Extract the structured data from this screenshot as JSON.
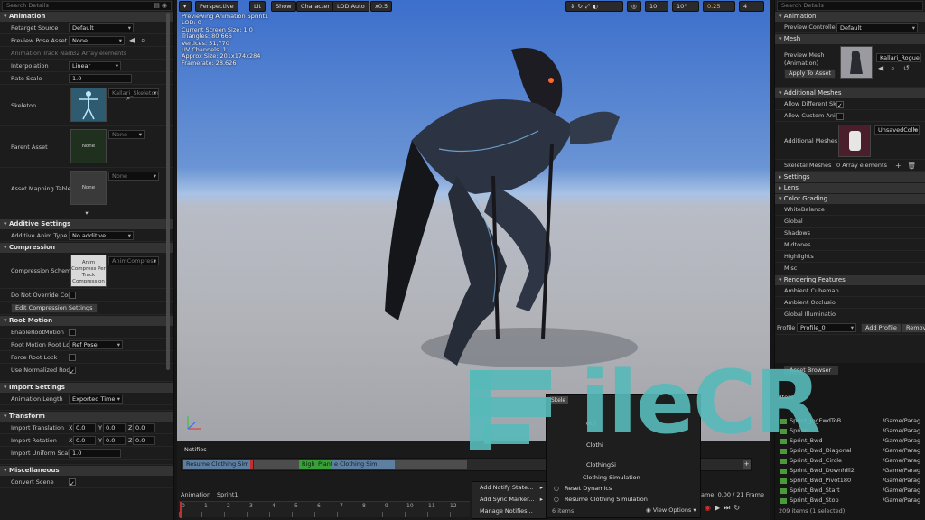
{
  "left_panel": {
    "search_placeholder": "Search Details",
    "categories": {
      "animation": "Animation",
      "additive": "Additive Settings",
      "compression": "Compression",
      "root_motion": "Root Motion",
      "import": "Import Settings",
      "transform": "Transform",
      "misc": "Miscellaneous"
    },
    "animation": {
      "retarget_label": "Retarget Source",
      "retarget_value": "Default",
      "preview_pose_label": "Preview Pose Asset",
      "preview_pose_value": "None",
      "track_names_label": "Animation Track Nam",
      "track_names_value": "132 Array elements",
      "interpolation_label": "Interpolation",
      "interpolation_value": "Linear",
      "rate_scale_label": "Rate Scale",
      "rate_scale_value": "1.0",
      "skeleton_label": "Skeleton",
      "skeleton_value": "Kallari_Skeleton",
      "parent_label": "Parent Asset",
      "parent_thumb": "None",
      "parent_value": "None",
      "mapping_label": "Asset Mapping Table",
      "mapping_thumb": "None",
      "mapping_value": "None"
    },
    "additive": {
      "anim_type_label": "Additive Anim Type",
      "anim_type_value": "No additive"
    },
    "compression": {
      "scheme_label": "Compression Schem",
      "scheme_thumb": "Anim Compress Per Track Compression",
      "scheme_value": "AnimCompress",
      "no_override_label": "Do Not Override Com",
      "edit_button": "Edit Compression Settings"
    },
    "root_motion": {
      "enable_label": "EnableRootMotion",
      "lock_label": "Root Motion Root Loc",
      "lock_value": "Ref Pose",
      "force_lock_label": "Force Root Lock",
      "normalized_label": "Use Normalized Root"
    },
    "import": {
      "length_label": "Animation Length",
      "length_value": "Exported Time"
    },
    "transform": {
      "translation_label": "Import Translation",
      "rotation_label": "Import Rotation",
      "scale_label": "Import Uniform Scale",
      "scale_value": "1.0",
      "axis_x": "X",
      "axis_y": "Y",
      "axis_z": "Z",
      "zero": "0.0"
    },
    "misc": {
      "convert_scene_label": "Convert Scene"
    }
  },
  "viewport": {
    "toolbar": {
      "perspective": "Perspective",
      "lit": "Lit",
      "show": "Show",
      "character": "Character",
      "lod": "LOD Auto",
      "speed": "x0.5",
      "grid_snap": "10",
      "rot_snap": "10°",
      "scale_snap": "0.25",
      "cam_speed": "4"
    },
    "stats": [
      "Previewing Animation Sprint1",
      "LOD: 0",
      "Current Screen Size: 1.0",
      "Triangles: 80,666",
      "Vertices: 51,770",
      "UV Channels: 1",
      "Approx Size: 201x174x284",
      "Framerate: 28.626"
    ]
  },
  "notifies": {
    "title": "Notifies",
    "track_1": "Resume Clothing Sim",
    "track_2a": "Righ",
    "track_2b": "Plant",
    "track_2c": "e Clothing Sim"
  },
  "timeline": {
    "animation_label": "Animation",
    "anim_name": "Sprint1",
    "frame_info": "ame: 0.00 / 21 Frame",
    "ticks": [
      "0",
      "1",
      "2",
      "3",
      "4",
      "5",
      "6",
      "7",
      "8",
      "9",
      "10",
      "11",
      "12"
    ]
  },
  "context_menu": {
    "items": [
      "Add Notify State...",
      "Add Sync Marker...",
      "Manage Notifies..."
    ]
  },
  "submenu": {
    "header": "Skele",
    "items": [
      "Reset Dynamics",
      "Resume Clothing Simulation"
    ],
    "partial_items": [
      "otif",
      "Clothi",
      "ClothingSi",
      "Clothing Simulation"
    ],
    "count": "6 items",
    "view_options": "View Options"
  },
  "right_panel": {
    "search_placeholder": "Search Details",
    "animation_cat": "Animation",
    "preview_controller_label": "Preview Controller",
    "preview_controller_value": "Default",
    "mesh_cat": "Mesh",
    "preview_mesh_label": "Preview Mesh (Animation)",
    "preview_mesh_value": "Kallari_Rogue",
    "apply_button": "Apply To Asset",
    "additional_cat": "Additional Meshes",
    "allow_diff_label": "Allow Different Ske",
    "allow_custom_label": "Allow Custom Anim",
    "additional_meshes_label": "Additional Meshes",
    "additional_meshes_value": "UnsavedColle",
    "skeletal_meshes_label": "Skeletal Meshes",
    "skeletal_meshes_value": "0 Array elements",
    "settings_cat": "Settings",
    "lens_cat": "Lens",
    "color_grading_cat": "Color Grading",
    "color_items": [
      "WhiteBalance",
      "Global",
      "Shadows",
      "Midtones",
      "Highlights",
      "Misc"
    ],
    "rendering_cat": "Rendering Features",
    "render_items": [
      "Ambient Cubemap",
      "Ambient Occlusio",
      "Global Illuminatio"
    ],
    "profile_label": "Profile",
    "profile_value": "Profile_0",
    "add_profile": "Add Profile",
    "remove_profile": "Remov",
    "asset_browser_tab": "Asset Browser",
    "filters": "ilters",
    "assets": [
      {
        "name": "Sprint_JogFwdToB",
        "path": "/Game/Parag"
      },
      {
        "name": "Sprint",
        "path": "/Game/Parag"
      },
      {
        "name": "Sprint_Bwd",
        "path": "/Game/Parag"
      },
      {
        "name": "Sprint_Bwd_Diagonal",
        "path": "/Game/Parag"
      },
      {
        "name": "Sprint_Bwd_Circle",
        "path": "/Game/Parag"
      },
      {
        "name": "Sprint_Bwd_Downhill2",
        "path": "/Game/Parag"
      },
      {
        "name": "Sprint_Bwd_Pivot180",
        "path": "/Game/Parag"
      },
      {
        "name": "Sprint_Bwd_Start",
        "path": "/Game/Parag"
      },
      {
        "name": "Sprint_Bwd_Stop",
        "path": "/Game/Parag"
      }
    ],
    "asset_count": "209 items (1 selected)"
  },
  "watermark": {
    "text": "ileCR"
  }
}
